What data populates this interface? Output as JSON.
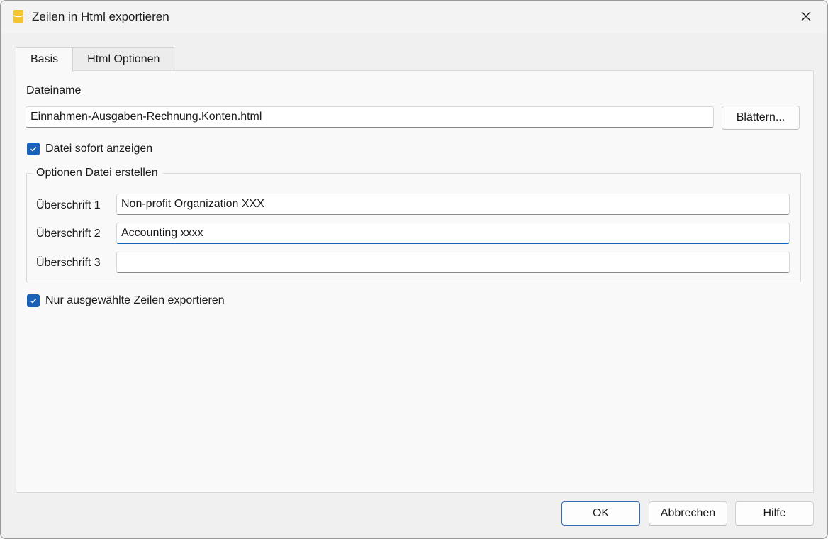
{
  "window": {
    "title": "Zeilen in Html exportieren",
    "accent_color": "#1a62b8",
    "icon_color": "#f4c430"
  },
  "tabs": [
    {
      "label": "Basis",
      "active": true
    },
    {
      "label": "Html Optionen",
      "active": false
    }
  ],
  "basis": {
    "filename_label": "Dateiname",
    "filename_value": "Einnahmen-Ausgaben-Rechnung.Konten.html",
    "browse_label": "Blättern...",
    "show_file_label": "Datei sofort anzeigen",
    "show_file_checked": true,
    "group_title": "Optionen Datei erstellen",
    "headings": [
      {
        "label": "Überschrift 1",
        "value": "Non-profit Organization XXX"
      },
      {
        "label": "Überschrift 2",
        "value": "Accounting xxxx"
      },
      {
        "label": "Überschrift 3",
        "value": ""
      }
    ],
    "selected_only_label": "Nur ausgewählte Zeilen exportieren",
    "selected_only_checked": true
  },
  "footer": {
    "ok_label": "OK",
    "cancel_label": "Abbrechen",
    "help_label": "Hilfe"
  }
}
